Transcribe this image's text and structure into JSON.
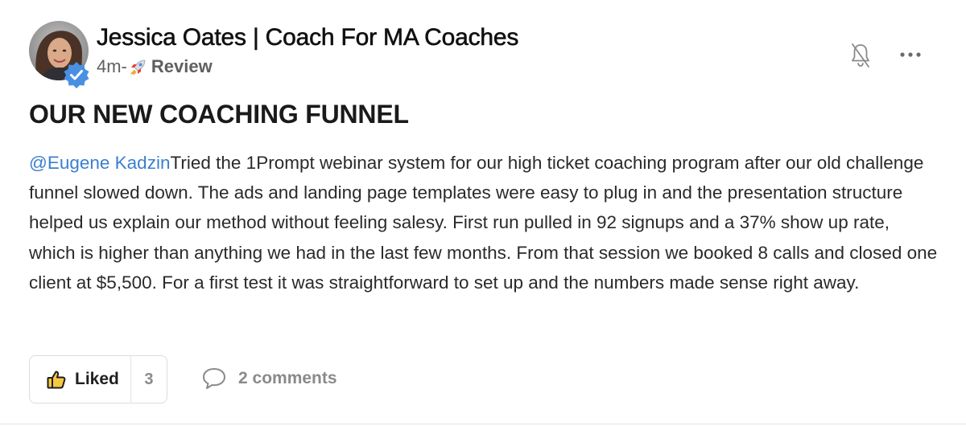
{
  "post": {
    "author": "Jessica Oates | Coach For MA Coaches",
    "time_ago": "4m-",
    "category_icon": "rocket-icon",
    "category": "Review",
    "title": "OUR NEW COACHING FUNNEL",
    "mention": "@Eugene Kadzin",
    "body": "Tried the 1Prompt webinar system for our high ticket coaching program after our old challenge funnel slowed down. The ads and landing page templates were easy to plug in and the presentation structure helped us explain our method without feeling salesy. First run pulled in 92 signups and a 37% show up rate, which is higher than anything we had in the last few months. From that session we booked 8 calls and closed one client at $5,500. For a first test it was straightforward to set up and the numbers made sense right away."
  },
  "actions": {
    "like_label": "Liked",
    "like_count": "3",
    "comments_label": "2 comments"
  },
  "colors": {
    "mention": "#3b7fd0",
    "verified_badge": "#4a90e2",
    "muted_text": "#8a8a8a"
  }
}
